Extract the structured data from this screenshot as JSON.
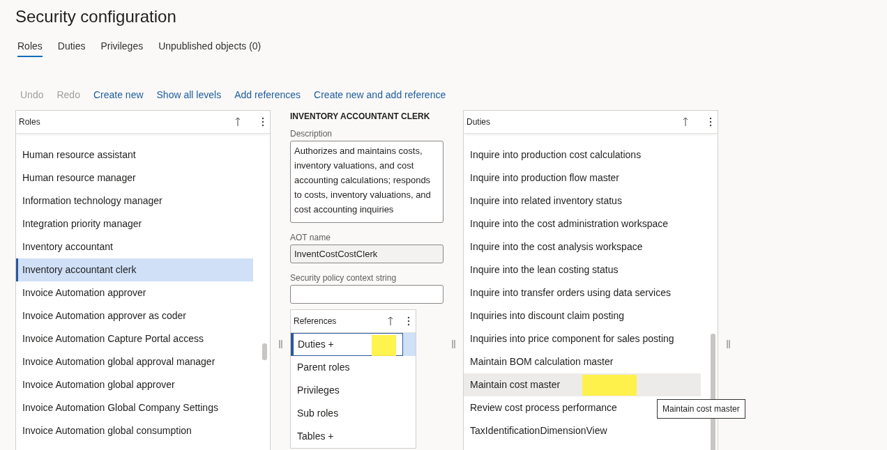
{
  "page": {
    "title": "Security configuration"
  },
  "tabs": [
    {
      "label": "Roles",
      "selected": true
    },
    {
      "label": "Duties",
      "selected": false
    },
    {
      "label": "Privileges",
      "selected": false
    },
    {
      "label": "Unpublished objects (0)",
      "selected": false
    }
  ],
  "actions": [
    {
      "label": "Undo",
      "disabled": true
    },
    {
      "label": "Redo",
      "disabled": true
    },
    {
      "label": "Create new",
      "disabled": false
    },
    {
      "label": "Show all levels",
      "disabled": false
    },
    {
      "label": "Add references",
      "disabled": false
    },
    {
      "label": "Create new and add reference",
      "disabled": false
    }
  ],
  "roles_panel": {
    "header": "Roles",
    "items": [
      {
        "label": "Human resource assistant",
        "selected": false
      },
      {
        "label": "Human resource manager",
        "selected": false
      },
      {
        "label": "Information technology manager",
        "selected": false
      },
      {
        "label": "Integration priority manager",
        "selected": false
      },
      {
        "label": "Inventory accountant",
        "selected": false
      },
      {
        "label": "Inventory accountant clerk",
        "selected": true
      },
      {
        "label": "Invoice Automation approver",
        "selected": false
      },
      {
        "label": "Invoice Automation approver as coder",
        "selected": false
      },
      {
        "label": "Invoice Automation Capture Portal access",
        "selected": false
      },
      {
        "label": "Invoice Automation global approval manager",
        "selected": false
      },
      {
        "label": "Invoice Automation global approver",
        "selected": false
      },
      {
        "label": "Invoice Automation Global Company Settings",
        "selected": false
      },
      {
        "label": "Invoice Automation global consumption",
        "selected": false
      }
    ]
  },
  "details": {
    "heading": "INVENTORY ACCOUNTANT CLERK",
    "fields": [
      {
        "label": "Description",
        "kind": "multiline",
        "value": "Authorizes and maintains costs, inventory valuations, and cost accounting calculations; responds to costs, inventory valuations, and cost accounting inquiries"
      },
      {
        "label": "AOT name",
        "kind": "readonly",
        "value": "InventCostCostClerk"
      },
      {
        "label": "Security policy context string",
        "kind": "text"
      }
    ]
  },
  "references_panel": {
    "header": "References",
    "items": [
      {
        "label": "Duties +",
        "selected": true,
        "highlighted": true
      },
      {
        "label": "Parent roles",
        "selected": false,
        "highlighted": false
      },
      {
        "label": "Privileges",
        "selected": false,
        "highlighted": false
      },
      {
        "label": "Sub roles",
        "selected": false,
        "highlighted": false
      },
      {
        "label": "Tables +",
        "selected": false,
        "highlighted": false
      }
    ]
  },
  "duties_panel": {
    "header": "Duties",
    "items": [
      {
        "label": "Inquire into production cost calculations",
        "hovered": false,
        "highlighted": false
      },
      {
        "label": "Inquire into production flow master",
        "hovered": false,
        "highlighted": false
      },
      {
        "label": "Inquire into related inventory status",
        "hovered": false,
        "highlighted": false
      },
      {
        "label": "Inquire into the cost administration workspace",
        "hovered": false,
        "highlighted": false
      },
      {
        "label": "Inquire into the cost analysis workspace",
        "hovered": false,
        "highlighted": false
      },
      {
        "label": "Inquire into the lean costing status",
        "hovered": false,
        "highlighted": false
      },
      {
        "label": "Inquire into transfer orders using data services",
        "hovered": false,
        "highlighted": false
      },
      {
        "label": "Inquiries into discount claim posting",
        "hovered": false,
        "highlighted": false
      },
      {
        "label": "Inquiries into price component for sales posting",
        "hovered": false,
        "highlighted": false
      },
      {
        "label": "Maintain BOM calculation master",
        "hovered": false,
        "highlighted": false
      },
      {
        "label": "Maintain cost master",
        "hovered": true,
        "highlighted": true
      },
      {
        "label": "Review cost process performance",
        "hovered": false,
        "highlighted": false
      },
      {
        "label": "TaxIdentificationDimensionView",
        "hovered": false,
        "highlighted": false
      }
    ]
  },
  "tooltip": {
    "text": "Maintain cost master"
  }
}
